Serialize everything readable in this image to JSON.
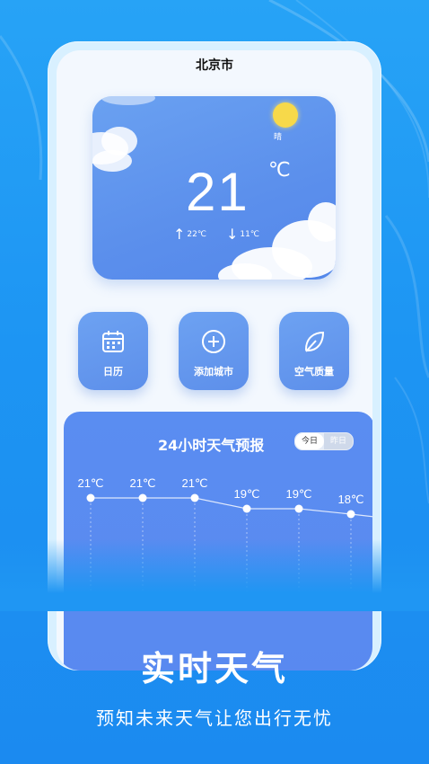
{
  "header": {
    "city": "北京市"
  },
  "current": {
    "condition": "晴",
    "temperature": "21",
    "unit": "℃",
    "high": "22℃",
    "low": "11℃"
  },
  "features": [
    {
      "label": "日历",
      "icon": "calendar-icon"
    },
    {
      "label": "添加城市",
      "icon": "plus-circle-icon"
    },
    {
      "label": "空气质量",
      "icon": "leaf-icon"
    }
  ],
  "forecast": {
    "title": "24小时天气预报",
    "toggle": {
      "today": "今日",
      "yesterday": "昨日",
      "selected": "今日"
    },
    "hours": [
      {
        "temp": "21℃",
        "value": 21
      },
      {
        "temp": "21℃",
        "value": 21
      },
      {
        "temp": "21℃",
        "value": 21
      },
      {
        "temp": "19℃",
        "value": 19
      },
      {
        "temp": "19℃",
        "value": 19
      },
      {
        "temp": "18℃",
        "value": 18
      }
    ]
  },
  "promo": {
    "headline": "实时天气",
    "subline": "预知未来天气让您出行无忧"
  },
  "colors": {
    "background": "#1d95f3",
    "card": "#5b8fec",
    "forecast_panel": "#5a8df1",
    "sun": "#f7d94a"
  }
}
